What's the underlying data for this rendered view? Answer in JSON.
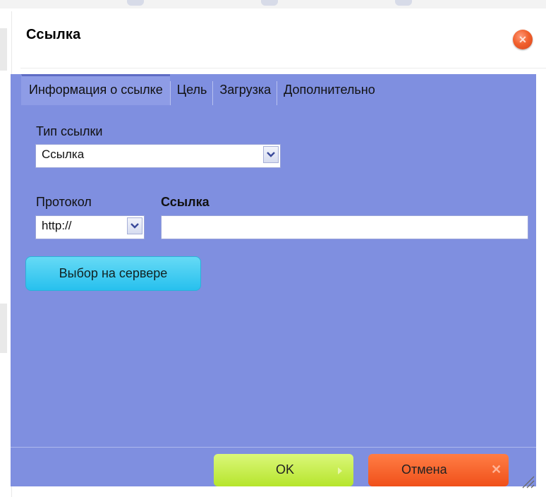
{
  "dialog": {
    "title": "Ссылка",
    "close_icon": "close-icon",
    "tabs": [
      {
        "label": "Информация о ссылке",
        "active": true
      },
      {
        "label": "Цель",
        "active": false
      },
      {
        "label": "Загрузка",
        "active": false
      },
      {
        "label": "Дополнительно",
        "active": false
      }
    ],
    "link_type": {
      "label": "Тип ссылки",
      "selected": "Ссылка"
    },
    "protocol": {
      "label": "Протокол",
      "selected": "http://"
    },
    "url": {
      "label": "Ссылка",
      "value": ""
    },
    "browse_server_label": "Выбор на сервере",
    "ok_label": "OK",
    "cancel_label": "Отмена",
    "colors": {
      "panel": "#7f8fe0",
      "ok": "#b6e52c",
      "cancel": "#f0501a",
      "browse": "#27c0ee"
    }
  }
}
